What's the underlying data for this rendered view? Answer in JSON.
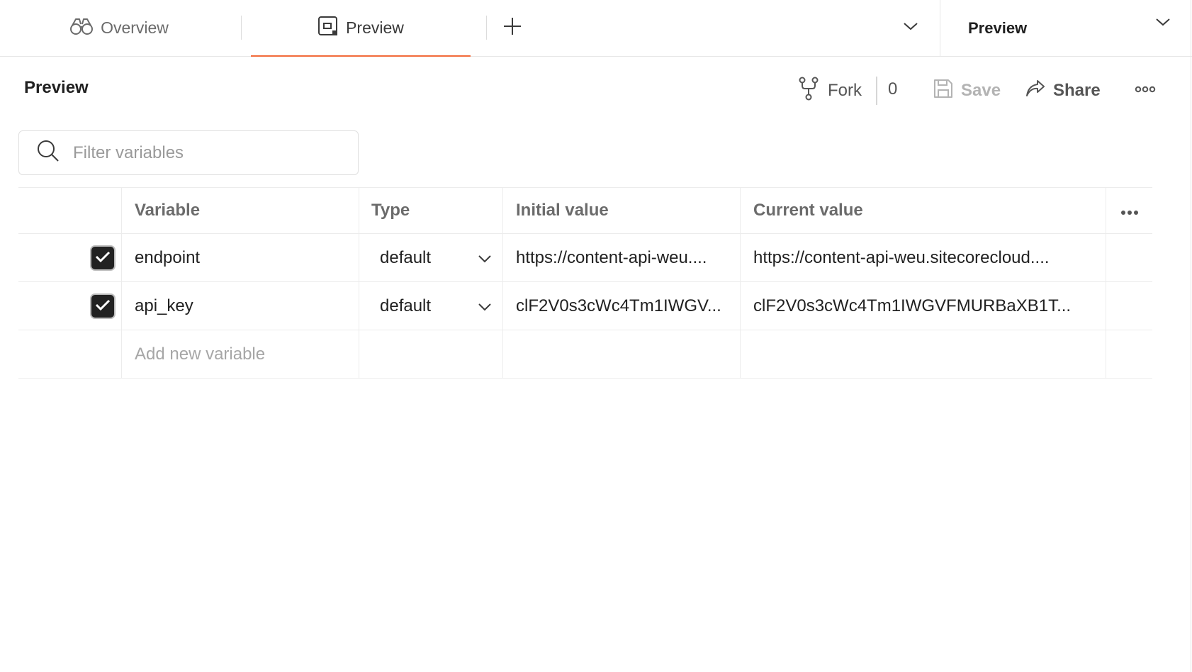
{
  "tabs": {
    "overview_label": "Overview",
    "preview_label": "Preview"
  },
  "environment": {
    "selected": "Preview"
  },
  "header": {
    "title": "Preview",
    "fork_label": "Fork",
    "fork_count": "0",
    "save_label": "Save",
    "share_label": "Share"
  },
  "filter": {
    "placeholder": "Filter variables",
    "value": ""
  },
  "table": {
    "columns": {
      "variable": "Variable",
      "type": "Type",
      "initial": "Initial value",
      "current": "Current value"
    },
    "rows": [
      {
        "checked": true,
        "variable": "endpoint",
        "type": "default",
        "initial": "https://content-api-weu....",
        "current": "https://content-api-weu.sitecorecloud...."
      },
      {
        "checked": true,
        "variable": "api_key",
        "type": "default",
        "initial": "clF2V0s3cWc4Tm1IWGV...",
        "current": "clF2V0s3cWc4Tm1IWGVFMURBaXB1T..."
      }
    ],
    "add_placeholder": "Add new variable"
  },
  "colors": {
    "accent": "#f26b3a",
    "text": "#212121",
    "muted": "#6b6b6b",
    "border": "#ececec"
  }
}
